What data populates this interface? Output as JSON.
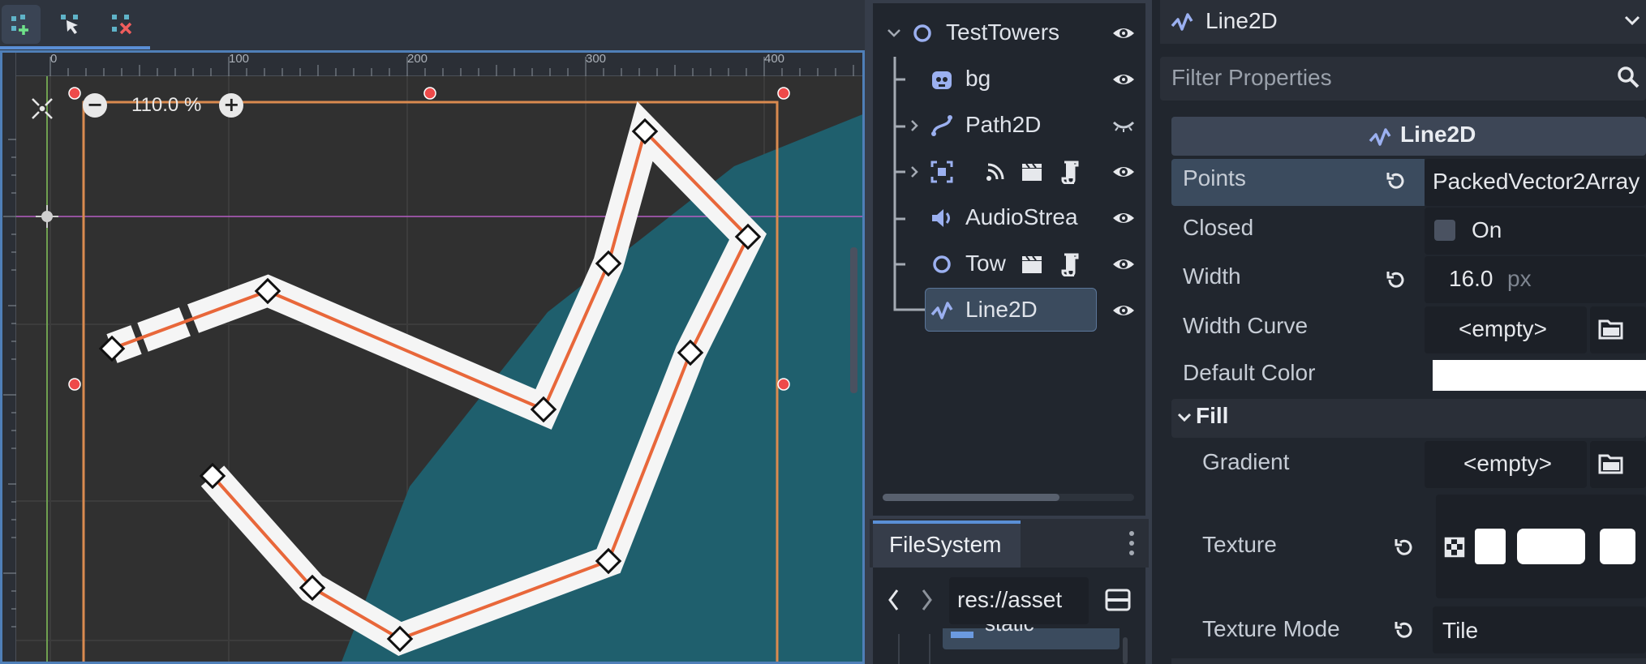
{
  "viewport": {
    "zoom_level": "110.0 %",
    "zoom_out_label": "−",
    "zoom_in_label": "+",
    "ruler_labels": [
      "0",
      "100",
      "200",
      "300",
      "400"
    ],
    "toolbar_tools": [
      "add-point-icon",
      "select-point-icon",
      "delete-point-icon"
    ],
    "colors": {
      "water": "#1f5f6d",
      "path_outline": "#f5f5f5",
      "path_core": "#e8673a",
      "bounds": "#d98a4f"
    }
  },
  "scene_tree": {
    "items": [
      {
        "label": "TestTowers",
        "icon": "node-circle-icon"
      },
      {
        "label": "bg",
        "icon": "godot-sprite-icon"
      },
      {
        "label": "Path2D",
        "icon": "path2d-icon"
      },
      {
        "label": "",
        "icon": "area2d-icon"
      },
      {
        "label": "AudioStrea",
        "icon": "audio-icon"
      },
      {
        "label": "Tow",
        "icon": "node-circle-icon"
      },
      {
        "label": "Line2D",
        "icon": "line2d-icon"
      }
    ]
  },
  "filesystem": {
    "tab_label": "FileSystem",
    "path": "res://asset",
    "item_label": "static"
  },
  "inspector": {
    "object_name": "Line2D",
    "filter_placeholder": "Filter Properties",
    "class_header": "Line2D",
    "properties": {
      "points": {
        "label": "Points",
        "value": "PackedVector2Array"
      },
      "closed": {
        "label": "Closed",
        "value": "On"
      },
      "width": {
        "label": "Width",
        "value": "16.0",
        "unit": "px"
      },
      "width_curve": {
        "label": "Width Curve",
        "value": "<empty>"
      },
      "default_color": {
        "label": "Default Color",
        "value_color": "#ffffff"
      }
    },
    "fill_section": "Fill",
    "fill": {
      "gradient": {
        "label": "Gradient",
        "value": "<empty>"
      },
      "texture": {
        "label": "Texture"
      },
      "texture_mode": {
        "label": "Texture Mode",
        "value": "Tile"
      }
    }
  }
}
